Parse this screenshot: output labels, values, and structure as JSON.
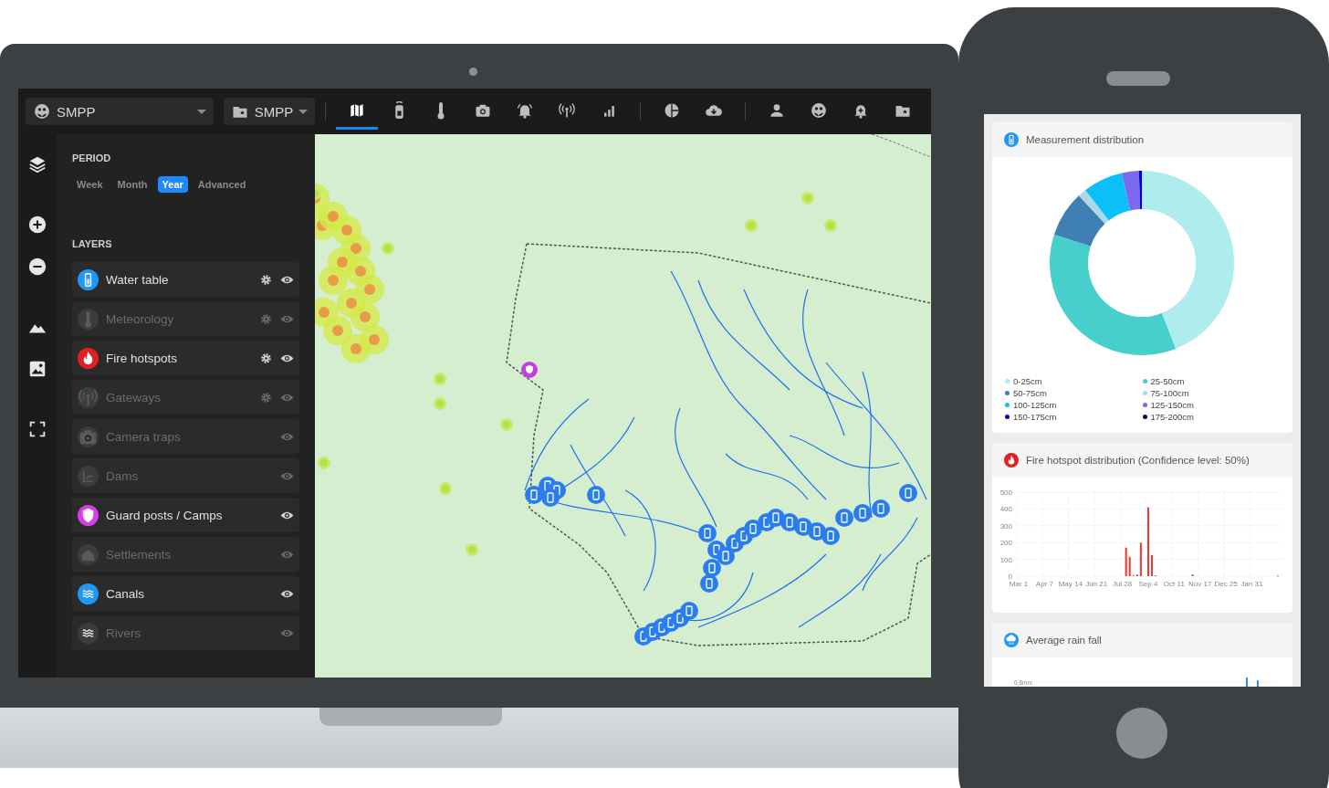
{
  "laptop": {
    "toolbar": {
      "selectors": [
        {
          "kind": "organization",
          "label": "SMPP"
        },
        {
          "kind": "folder",
          "label": "SMPP"
        }
      ],
      "tool_groups": [
        [
          {
            "kind": "map",
            "selected": true
          },
          {
            "kind": "tracker",
            "selected": false
          },
          {
            "kind": "thermometer",
            "selected": false
          },
          {
            "kind": "camera",
            "selected": false
          },
          {
            "kind": "alarm",
            "selected": false
          },
          {
            "kind": "antenna",
            "selected": false
          },
          {
            "kind": "bars",
            "selected": false
          }
        ],
        [
          {
            "kind": "pie",
            "selected": false
          },
          {
            "kind": "cloud",
            "selected": false
          }
        ],
        [
          {
            "kind": "person",
            "selected": false
          },
          {
            "kind": "organization",
            "selected": false
          },
          {
            "kind": "bell-plus",
            "selected": false
          },
          {
            "kind": "folder",
            "selected": false
          }
        ]
      ]
    },
    "period": {
      "title": "PERIOD",
      "options": [
        {
          "label": "Week",
          "selected": false
        },
        {
          "label": "Month",
          "selected": false
        },
        {
          "label": "Year",
          "selected": true
        },
        {
          "label": "Advanced",
          "selected": false
        }
      ]
    },
    "layers": {
      "title": "LAYERS",
      "items": [
        {
          "kind": "gauge",
          "label": "Water table",
          "enabled": true,
          "color": "#2196f3",
          "settings": true
        },
        {
          "kind": "thermometer",
          "label": "Meteorology",
          "enabled": false,
          "settings": true
        },
        {
          "kind": "flame",
          "label": "Fire hotspots",
          "enabled": true,
          "color": "#e31e24",
          "settings": true
        },
        {
          "kind": "antenna",
          "label": "Gateways",
          "enabled": false,
          "settings": true
        },
        {
          "kind": "camera",
          "label": "Camera traps",
          "enabled": false,
          "settings": false
        },
        {
          "kind": "dam",
          "label": "Dams",
          "enabled": false,
          "settings": false
        },
        {
          "kind": "shield",
          "label": "Guard posts / Camps",
          "enabled": true,
          "color": "#d43fe6",
          "settings": false
        },
        {
          "kind": "house",
          "label": "Settlements",
          "enabled": false,
          "settings": false
        },
        {
          "kind": "waves",
          "label": "Canals",
          "enabled": true,
          "color": "#2196f3",
          "settings": false
        },
        {
          "kind": "waves",
          "label": "Rivers",
          "enabled": false,
          "settings": false
        }
      ]
    }
  },
  "phone": {
    "cards": [
      {
        "kind": "donut",
        "title": "Measurement distribution",
        "chart_data": {
          "type": "donut",
          "categories": [
            "0-25cm",
            "25-50cm",
            "50-75cm",
            "75-100cm",
            "100-125cm",
            "125-150cm",
            "150-175cm",
            "175-200cm"
          ],
          "values": [
            44,
            36,
            8,
            1.5,
            7,
            3,
            0.5,
            0
          ]
        },
        "legend": [
          {
            "color": "#aeeced"
          },
          {
            "color": "#47d0cb"
          },
          {
            "color": "#3f7fb4"
          },
          {
            "color": "#add8e6"
          },
          {
            "color": "#0bbff8"
          },
          {
            "color": "#7b68ee"
          },
          {
            "color": "#0000cd"
          },
          {
            "color": "#0b0b5e"
          }
        ]
      },
      {
        "kind": "bar",
        "title": "Fire hotspot distribution (Confidence level: 50%)",
        "chart_data": {
          "type": "bar",
          "grid": true,
          "ylim": [
            0,
            500
          ],
          "yticks": [
            0,
            100,
            200,
            300,
            400,
            500
          ],
          "categories": [
            "Mar 1",
            null,
            null,
            null,
            null,
            null,
            null,
            "Apr 7",
            null,
            null,
            null,
            null,
            null,
            null,
            "May 14",
            null,
            null,
            null,
            null,
            null,
            null,
            "Jun 21",
            null,
            null,
            null,
            null,
            null,
            null,
            "Jul 28",
            null,
            null,
            null,
            null,
            null,
            null,
            "Sep 4",
            null,
            null,
            null,
            null,
            null,
            null,
            "Oct 11",
            null,
            null,
            null,
            null,
            null,
            null,
            "Nov 17",
            null,
            null,
            null,
            null,
            null,
            null,
            "Dec 25",
            null,
            null,
            null,
            null,
            null,
            null,
            "Jan 31",
            null,
            null,
            null,
            null,
            null,
            null,
            null,
            null
          ],
          "series": [
            {
              "color": "#e53935",
              "values": [
                null,
                null,
                null,
                null,
                null,
                null,
                null,
                null,
                null,
                null,
                null,
                null,
                null,
                null,
                null,
                null,
                null,
                null,
                null,
                null,
                null,
                null,
                null,
                null,
                null,
                null,
                null,
                null,
                null,
                170,
                115,
                4,
                10,
                200,
                null,
                410,
                125,
                5,
                null,
                null,
                null,
                null,
                null,
                null,
                null,
                null,
                null,
                10,
                null,
                null,
                null,
                null,
                null,
                null,
                null,
                null,
                null,
                null,
                null,
                null,
                null,
                null,
                null,
                null,
                null,
                null,
                null,
                null,
                null,
                null,
                3,
                null
              ]
            }
          ]
        }
      },
      {
        "kind": "rain",
        "title": "Average rain fall",
        "axis_label": "0.6mm"
      }
    ]
  }
}
